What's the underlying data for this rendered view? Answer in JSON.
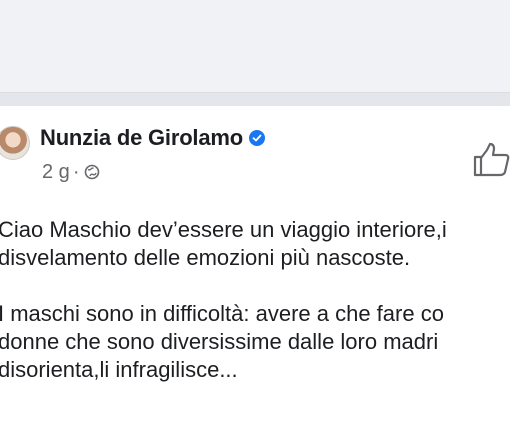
{
  "post": {
    "author": "Nunzia de Girolamo",
    "time": "2 g",
    "separator": "·",
    "paragraphs": [
      [
        "Ciao Maschio dev’essere un viaggio interiore,i",
        "disvelamento delle emozioni più nascoste."
      ],
      [
        "I maschi sono in difficoltà: avere a che fare co",
        "donne che sono diversissime dalle loro madri",
        "disorienta,li infragilisce..."
      ]
    ]
  },
  "icons": {
    "avatar": "profile-photo",
    "verified": "verified-badge-icon",
    "audience": "globe-icon",
    "like": "thumbs-up-icon"
  },
  "colors": {
    "verified": "#1877f2",
    "meta_text": "#65676b",
    "body_text": "#1c1e21"
  }
}
